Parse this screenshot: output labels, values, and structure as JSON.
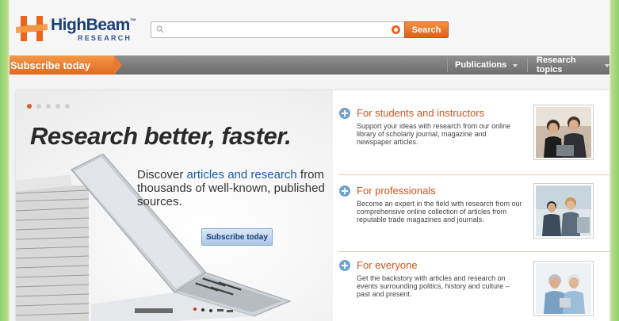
{
  "brand": {
    "name": "HighBeam",
    "tm": "™",
    "subtitle": "RESEARCH",
    "colors": {
      "primary": "#1a3f7a",
      "accent": "#e06822"
    }
  },
  "search": {
    "placeholder": "",
    "button_label": "Search"
  },
  "nav": {
    "subscribe_label": "Subscribe today",
    "items": [
      {
        "label": "Publications"
      },
      {
        "label": "Research topics"
      }
    ]
  },
  "hero": {
    "slides": 5,
    "active_slide": 1,
    "title": "Research better, faster.",
    "text_before": "Discover ",
    "text_link": "articles and research",
    "text_after": " from thousands of well-known, published sources.",
    "button_label": "Subscribe today"
  },
  "features": [
    {
      "title": "For students and instructors",
      "description": "Support your ideas with research from our online library of scholarly journal, magazine and newspaper articles."
    },
    {
      "title": "For professionals",
      "description": "Become an expert in the field with research from our comprehensive online collection of articles from reputable trade magazines and journals."
    },
    {
      "title": "For everyone",
      "description": "Get the backstory with articles and research on events surrounding politics, history and culture – past and present."
    }
  ]
}
